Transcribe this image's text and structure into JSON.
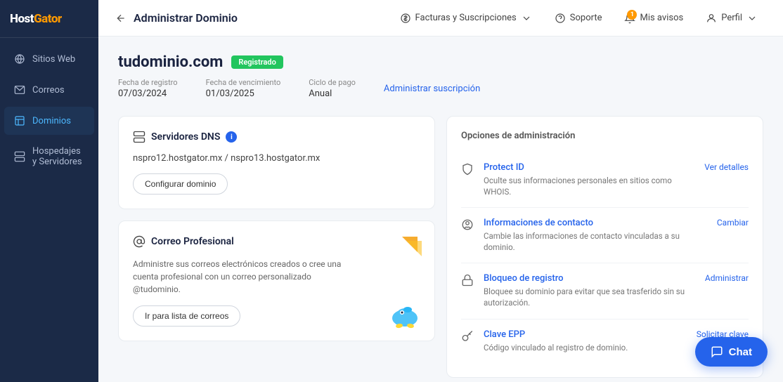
{
  "sidebar": {
    "logo_line1": "Host",
    "logo_line2": "Gator",
    "items": [
      {
        "id": "sitios-web",
        "label": "Sitios Web",
        "icon": "globe"
      },
      {
        "id": "correos",
        "label": "Correos",
        "icon": "mail"
      },
      {
        "id": "dominios",
        "label": "Dominios",
        "icon": "layers",
        "active": true
      },
      {
        "id": "hospedajes",
        "label": "Hospedajes y Servidores",
        "icon": "server"
      }
    ]
  },
  "topnav": {
    "back_label": "Administrar Dominio",
    "items": [
      {
        "id": "facturas",
        "label": "Facturas y Suscripciones",
        "has_chevron": true
      },
      {
        "id": "soporte",
        "label": "Soporte",
        "has_chevron": false
      },
      {
        "id": "avisos",
        "label": "Mis avisos",
        "has_chevron": false
      },
      {
        "id": "perfil",
        "label": "Perfil",
        "has_chevron": true
      }
    ]
  },
  "domain": {
    "name": "tudominio.com",
    "badge": "Registrado",
    "meta": [
      {
        "label": "Fecha de registro",
        "value": "07/03/2024"
      },
      {
        "label": "Fecha de vencimiento",
        "value": "01/03/2025"
      },
      {
        "label": "Ciclo de pago",
        "value": "Anual"
      }
    ],
    "meta_link": "Administrar suscripción"
  },
  "dns_card": {
    "title": "Servidores DNS",
    "servers": "nspro12.hostgator.mx  /  nspro13.hostgator.mx",
    "btn_label": "Configurar dominio"
  },
  "mail_card": {
    "title": "Correo Profesional",
    "desc": "Administre sus correos electrónicos creados o cree una cuenta profesional con un correo personalizado @tudominio.",
    "btn_label": "Ir para lista de correos"
  },
  "admin_options": {
    "section_title": "Opciones de administración",
    "items": [
      {
        "id": "protect-id",
        "title": "Protect ID",
        "desc": "Oculte sus informaciones personales en sitios como WHOIS.",
        "link": "Ver detalles",
        "icon": "shield"
      },
      {
        "id": "info-contacto",
        "title": "Informaciones de contacto",
        "desc": "Cambie las informaciones de contacto vinculadas a su dominio.",
        "link": "Cambiar",
        "icon": "user"
      },
      {
        "id": "bloqueo",
        "title": "Bloqueo de registro",
        "desc": "Bloquee su dominio para evitar que sea trasferido sin su autorización.",
        "link": "Administrar",
        "icon": "lock"
      },
      {
        "id": "clave-epp",
        "title": "Clave EPP",
        "desc": "Código vinculado al registro de dominio.",
        "link": "Solicitar clave",
        "icon": "key"
      }
    ]
  },
  "chat": {
    "label": "Chat"
  },
  "notification_count": "1"
}
